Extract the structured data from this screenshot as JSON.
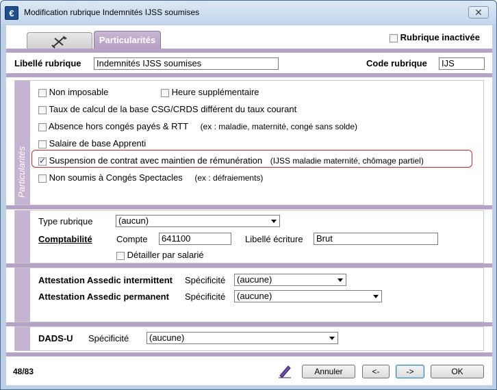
{
  "window": {
    "title": "Modification rubrique Indemnités IJSS soumises",
    "app_icon": "€",
    "close_label": "✕"
  },
  "tabs": [
    {
      "name": "icon-tab",
      "icon": "tools-icon"
    },
    {
      "label": "Particularités"
    }
  ],
  "inactive": {
    "label": "Rubrique inactivée",
    "checked": false
  },
  "header": {
    "libelle_label": "Libellé rubrique",
    "libelle_value": "Indemnités IJSS soumises",
    "code_label": "Code rubrique",
    "code_value": "IJS"
  },
  "particularites": {
    "side_title": "Particularités",
    "non_imposable": "Non imposable",
    "heure_sup": "Heure supplémentaire",
    "taux_csg": "Taux de calcul de la base CSG/CRDS différent du taux courant",
    "absence": "Absence hors congés payés & RTT",
    "absence_hint": "(ex : maladie, maternité, congé sans solde)",
    "salaire_apprenti": "Salaire de base Apprenti",
    "suspension": "Suspension de contrat avec maintien de rémunération",
    "suspension_hint": "(IJSS maladie maternité, chômage partiel)",
    "non_soumis": "Non soumis à Congés Spectacles",
    "non_soumis_hint": "(ex : défraiements)"
  },
  "compta": {
    "type_label": "Type rubrique",
    "type_value": "(aucun)",
    "comptabilite_label": "Comptabilité",
    "compte_label": "Compte",
    "compte_value": "641100",
    "libelle_ecriture_label": "Libellé écriture",
    "libelle_ecriture_value": "Brut",
    "detailler_label": "Détailler par salarié"
  },
  "assedic": {
    "intermittent_label": "Attestation Assedic intermittent",
    "specificite_label": "Spécificité",
    "intermittent_value": "(aucune)",
    "permanent_label": "Attestation Assedic permanent",
    "permanent_value": "(aucune)"
  },
  "dadsu": {
    "label": "DADS-U",
    "specificite_label": "Spécificité",
    "value": "(aucune)"
  },
  "footer": {
    "counter": "48/83",
    "cancel": "Annuler",
    "prev": "<-",
    "next": "->",
    "ok": "OK"
  },
  "colors": {
    "accent": "#b7a2c7",
    "highlight": "#e02424"
  }
}
